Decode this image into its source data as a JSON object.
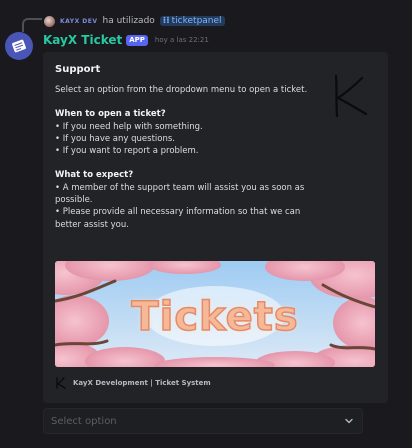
{
  "reply": {
    "username": "KAYX DEV",
    "action_text": "ha utilizado",
    "command": "ticketpanel"
  },
  "message": {
    "bot_name": "KayX Ticket",
    "badge": "APP",
    "timestamp": "hoy a las 22:21"
  },
  "embed": {
    "title": "Support",
    "intro": "Select an option from the dropdown menu to open a ticket.",
    "when_heading": "When to open a ticket?",
    "when_items": [
      "• If you need help with something.",
      "• If you have any questions.",
      "• If you want to report a problem."
    ],
    "expect_heading": "What to expect?",
    "expect_items": [
      "• A member of the support team will assist you as soon as possible.",
      "• Please provide all necessary information so that we can better assist you."
    ],
    "thumbnail_letter": "K",
    "image_text": "Tickets",
    "footer_text": "KayX Development | Ticket System"
  },
  "select": {
    "placeholder": "Select option"
  },
  "colors": {
    "background": "#1a1a1e",
    "embed_background": "#222327",
    "bot_name": "#26c9a2",
    "app_badge": "#5865f2",
    "command_pill": "#233b5a"
  },
  "icons": {
    "bot_avatar": "blue-card-logo",
    "command": "slash-command-icon",
    "select_arrow": "chevron-down-icon"
  }
}
